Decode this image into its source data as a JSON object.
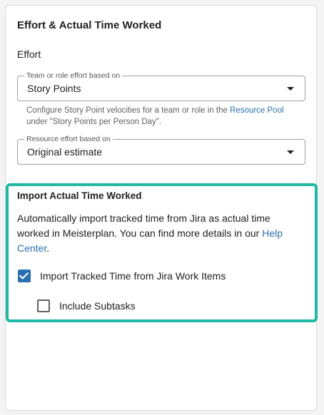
{
  "card": {
    "title": "Effort & Actual Time Worked"
  },
  "effort": {
    "label": "Effort",
    "team_select": {
      "legend": "Team or role effort based on",
      "value": "Story Points"
    },
    "helper": {
      "text_before": "Configure Story Point velocities for a team or role in the ",
      "link": "Resource Pool",
      "text_after": " under \"Story Points per Person Day\"."
    },
    "resource_select": {
      "legend": "Resource effort based on",
      "value": "Original estimate"
    }
  },
  "import": {
    "title": "Import Actual Time Worked",
    "description_before": "Automatically import tracked time from Jira as actual time worked in Meisterplan. You can find more details in our ",
    "description_link": "Help Center",
    "description_after": ".",
    "checkbox_tracked": {
      "label": "Import Tracked Time from Jira Work Items",
      "checked": true
    },
    "checkbox_subtasks": {
      "label": "Include Subtasks",
      "checked": false
    }
  },
  "colors": {
    "highlight": "#1fb8a4",
    "link": "#2a6fb0",
    "checkbox": "#2a6fb0"
  }
}
